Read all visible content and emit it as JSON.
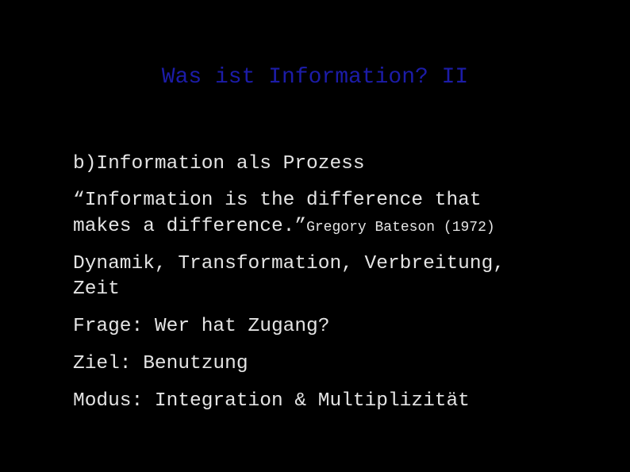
{
  "slide": {
    "title": "Was ist Information? II",
    "colors": {
      "background": "#000000",
      "title": "#1c1ca8",
      "text": "#e4e4e4"
    },
    "items": [
      {
        "text": "b)Information als Prozess"
      },
      {
        "quote_line1": "“Information is the difference that",
        "quote_line2": "makes a difference.”",
        "attribution": "Gregory Bateson (1972)"
      },
      {
        "line1": "Dynamik, Transformation, Verbreitung,",
        "line2": "Zeit"
      },
      {
        "text": "Frage: Wer hat Zugang?"
      },
      {
        "text": "Ziel: Benutzung"
      },
      {
        "text": "Modus: Integration & Multiplizität"
      }
    ]
  }
}
